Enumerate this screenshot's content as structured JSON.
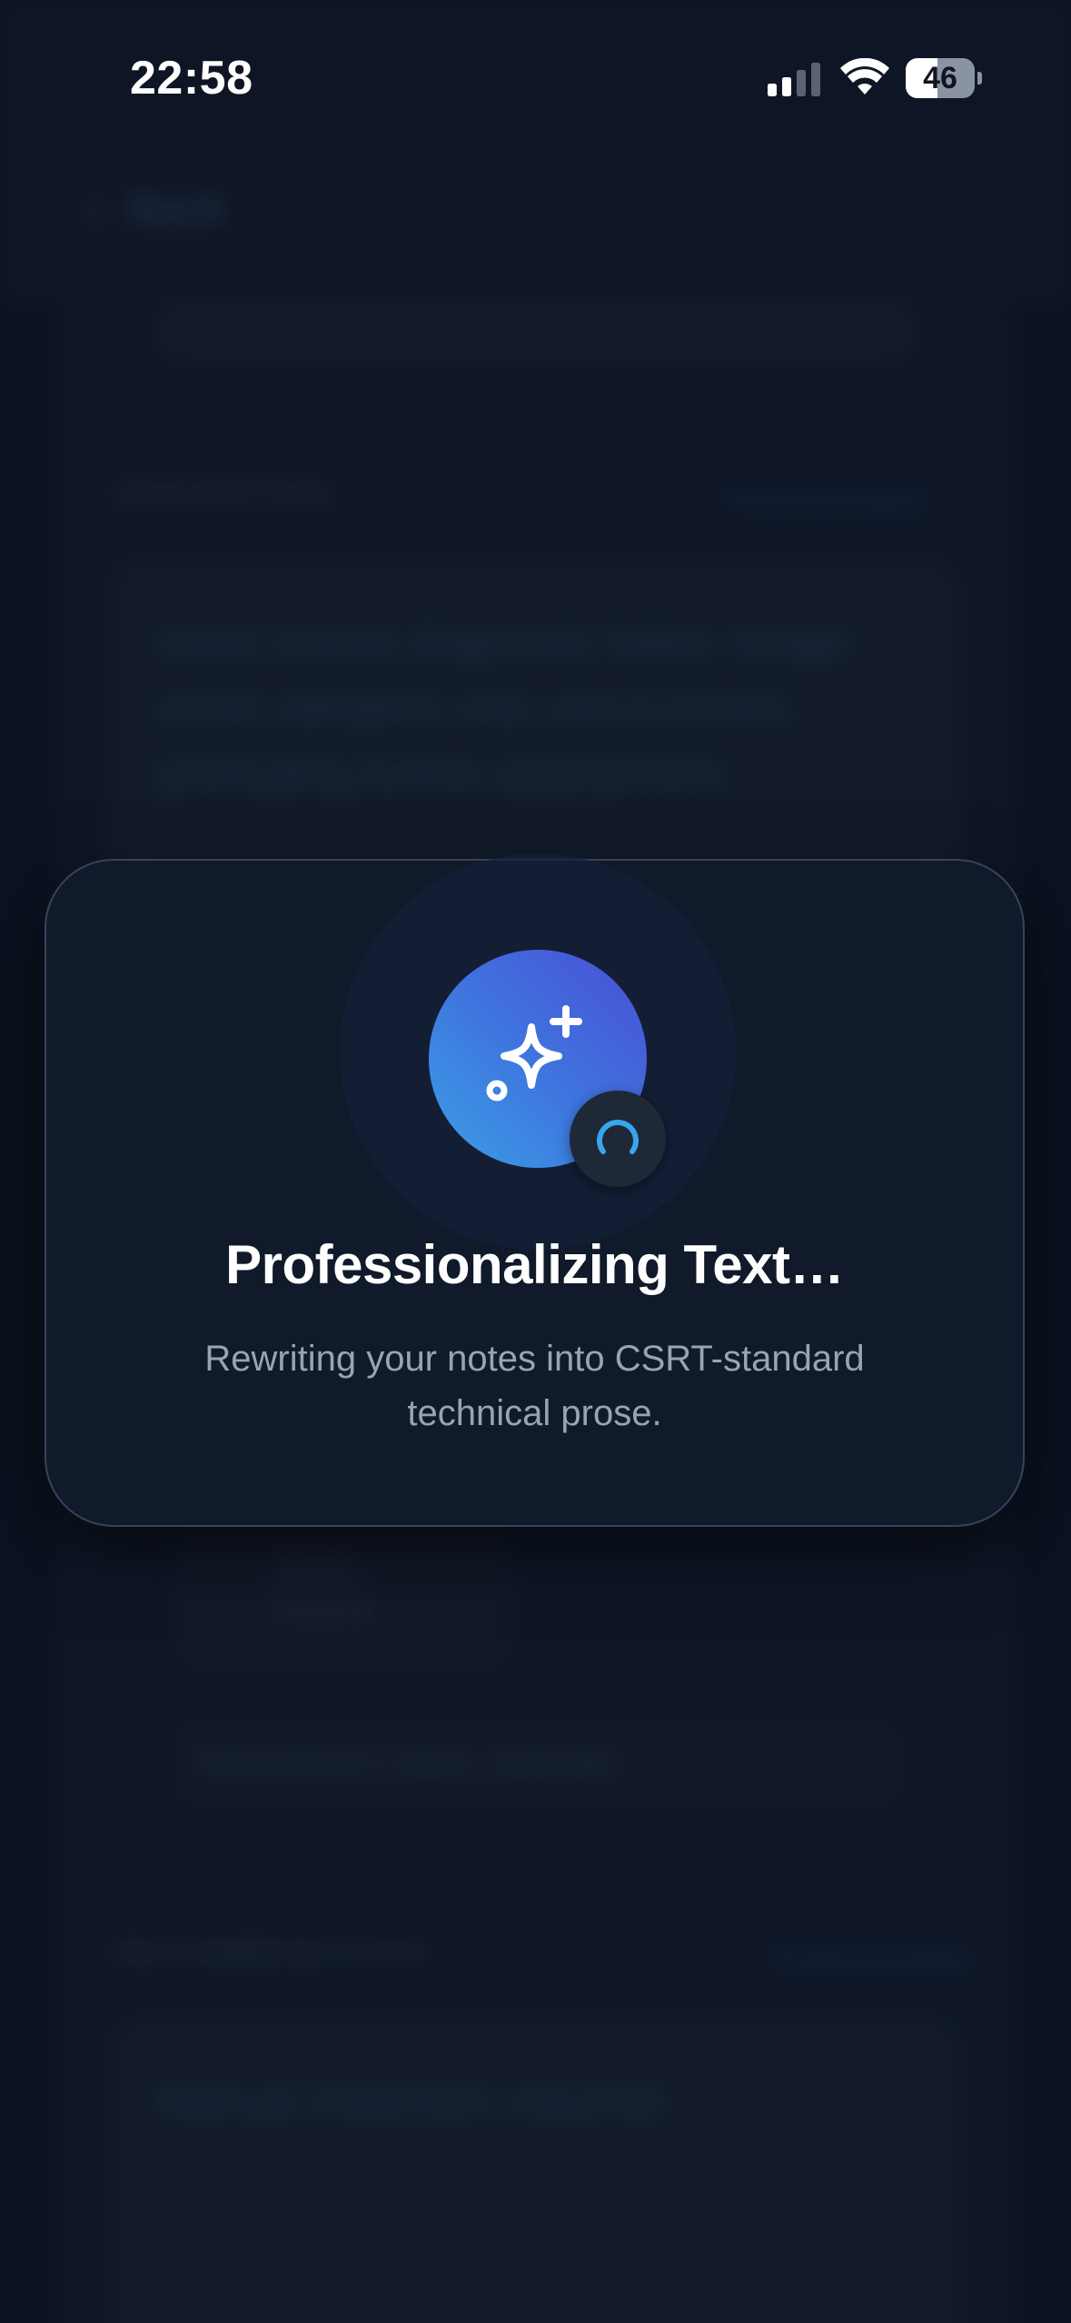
{
  "status_bar": {
    "time": "22:58",
    "battery_level": "46",
    "battery_fraction": 0.46
  },
  "background": {
    "back_label": "Back",
    "description_title": "DESCRIPTION",
    "description_action": "Professionalize",
    "description_text": "Initial remote diagnostic failed. Image asset validation was unsuccessful, precluding further assessment.",
    "chip_label": "Status Defects",
    "input_placeholder": "Recommend a status, optionally…",
    "recommendation_title": "RECOMMENDATION",
    "recommendation_action": "Professionalize",
    "recommendation_text": "Manual inspection required."
  },
  "modal": {
    "title": "Professionalizing Text…",
    "subtitle": "Rewriting your notes into CSRT-standard technical prose.",
    "icon": "sparkles-icon",
    "spinner": "loading-spinner-icon",
    "gradient_start": "#3a9fe6",
    "gradient_end": "#4a4fd6"
  }
}
